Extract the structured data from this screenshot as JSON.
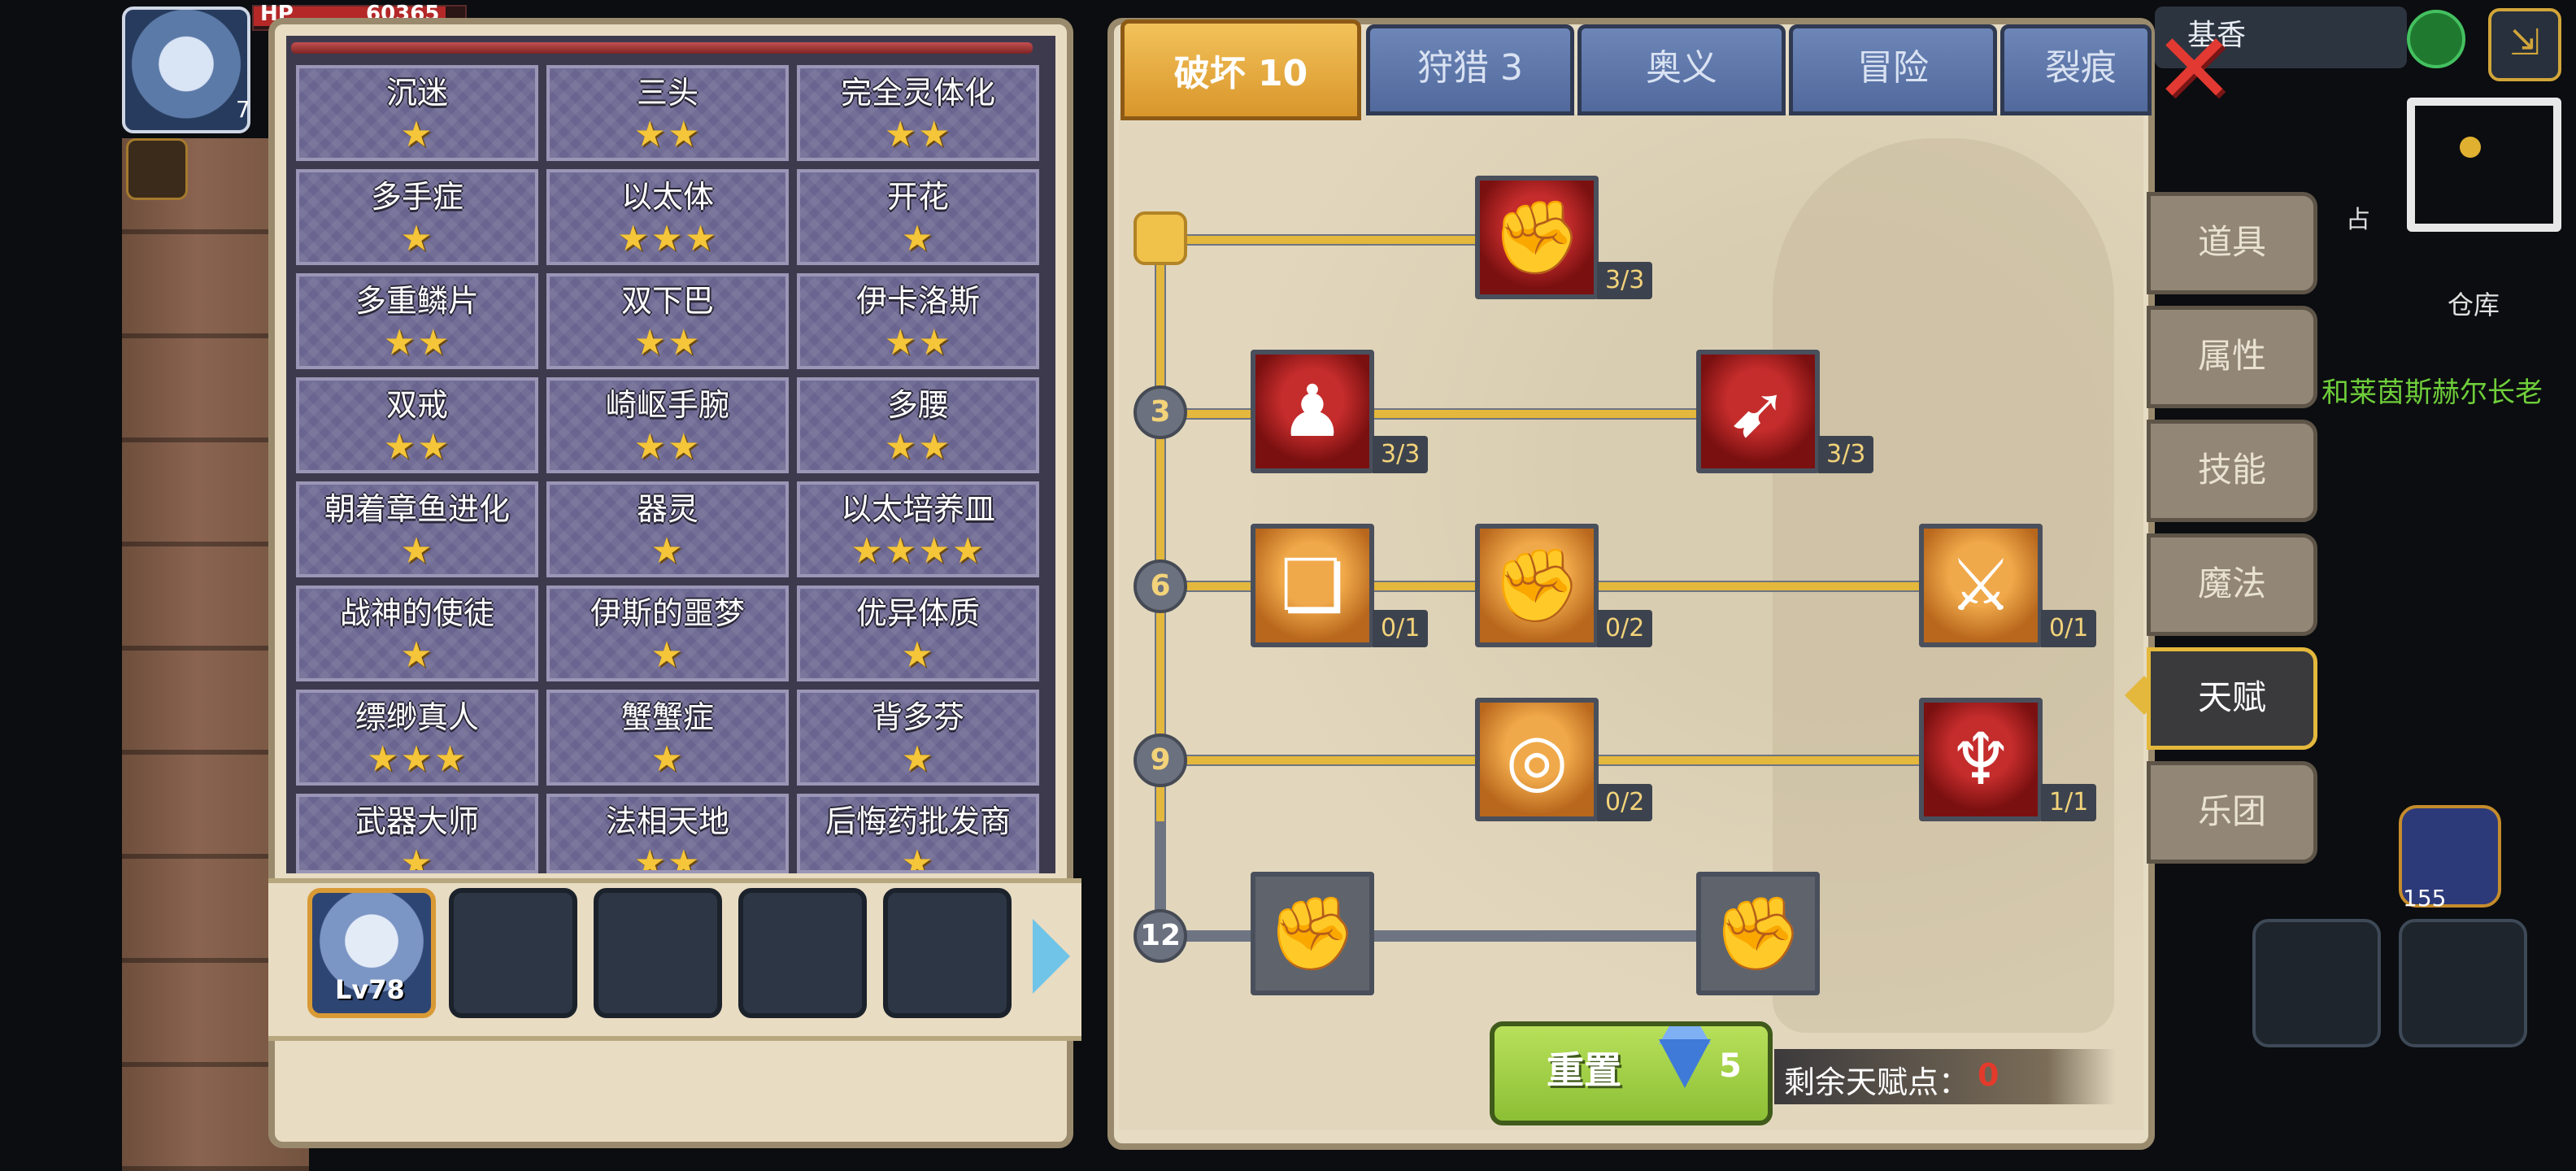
{
  "hud": {
    "hp_label": "HP",
    "hp_value": "60365",
    "level": "7",
    "right_name": "基香",
    "warehouse": "仓库",
    "npc_name": "和莱茵斯赫尔长老",
    "bag_count": "155",
    "shop_tag": "占"
  },
  "traits": [
    {
      "name": "沉迷",
      "stars": "★"
    },
    {
      "name": "三头",
      "stars": "★★"
    },
    {
      "name": "完全灵体化",
      "stars": "★★"
    },
    {
      "name": "多手症",
      "stars": "★"
    },
    {
      "name": "以太体",
      "stars": "★★★"
    },
    {
      "name": "开花",
      "stars": "★"
    },
    {
      "name": "多重鳞片",
      "stars": "★★"
    },
    {
      "name": "双下巴",
      "stars": "★★"
    },
    {
      "name": "伊卡洛斯",
      "stars": "★★"
    },
    {
      "name": "双戒",
      "stars": "★★"
    },
    {
      "name": "崎岖手腕",
      "stars": "★★"
    },
    {
      "name": "多腰",
      "stars": "★★"
    },
    {
      "name": "朝着章鱼进化",
      "stars": "★"
    },
    {
      "name": "器灵",
      "stars": "★"
    },
    {
      "name": "以太培养皿",
      "stars": "★★★★"
    },
    {
      "name": "战神的使徒",
      "stars": "★"
    },
    {
      "name": "伊斯的噩梦",
      "stars": "★"
    },
    {
      "name": "优异体质",
      "stars": "★"
    },
    {
      "name": "缥缈真人",
      "stars": "★★★"
    },
    {
      "name": "蟹蟹症",
      "stars": "★"
    },
    {
      "name": "背多芬",
      "stars": "★"
    },
    {
      "name": "武器大师",
      "stars": "★"
    },
    {
      "name": "法相天地",
      "stars": "★★"
    },
    {
      "name": "后悔药批发商",
      "stars": "★"
    }
  ],
  "party": {
    "first_level": "Lv78"
  },
  "tabs": [
    "破坏 10",
    "狩猎 3",
    "奥义",
    "冒险",
    "裂痕"
  ],
  "nodes": [
    "",
    "3",
    "6",
    "9",
    "12"
  ],
  "skills": [
    {
      "id": "arm-wrestle",
      "count": "3/3",
      "icon": "✊"
    },
    {
      "id": "muscle-body",
      "count": "3/3",
      "icon": "♟"
    },
    {
      "id": "arrow-slash",
      "count": "3/3",
      "icon": "➹"
    },
    {
      "id": "card-spin",
      "count": "0/1",
      "icon": "❏"
    },
    {
      "id": "power-fist",
      "count": "0/2",
      "icon": "✊"
    },
    {
      "id": "blade-splash",
      "count": "0/1",
      "icon": "⚔"
    },
    {
      "id": "ring-orb",
      "count": "0/2",
      "icon": "◎"
    },
    {
      "id": "demon-wings",
      "count": "1/1",
      "icon": "♆"
    },
    {
      "id": "locked-fist-a",
      "count": "",
      "icon": "✊"
    },
    {
      "id": "locked-fist-b",
      "count": "",
      "icon": "✊"
    }
  ],
  "reset": {
    "label": "重置",
    "cost": "5",
    "remaining_label": "剩余天赋点：",
    "remaining_value": "0"
  },
  "side_tabs": [
    "道具",
    "属性",
    "技能",
    "魔法",
    "天赋",
    "乐团"
  ],
  "close_icon": "✕",
  "colors": {
    "accent_gold": "#e4b83c",
    "active_tab": "#d9962b",
    "reset_green": "#8cbf35",
    "points_red": "#e43a2c"
  }
}
